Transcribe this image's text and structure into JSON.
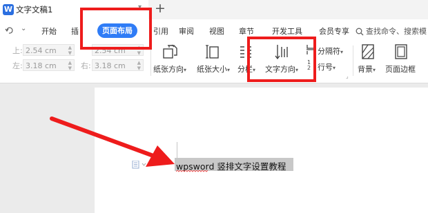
{
  "titlebar": {
    "app_icon": "W",
    "doc_title": "文字文稿1",
    "new_tab_label": "+"
  },
  "menubar": {
    "items": [
      "开始",
      "插入",
      "页面布局",
      "引用",
      "审阅",
      "视图",
      "章节",
      "开发工具",
      "会员专享"
    ],
    "partial_labels": {
      "insert": "插",
      "reference": "引用"
    },
    "active": "页面布局",
    "search_label": "查找命令、搜索模"
  },
  "ribbon": {
    "margins": {
      "top_label": "上:",
      "top_value": "2.54 cm",
      "left_label": "左:",
      "left_value": "3.18 cm",
      "right_label": "右:",
      "right_value": "3.18 cm",
      "bottom_value": "2.54 cm"
    },
    "buttons": {
      "orientation": "纸张方向",
      "paper_size": "纸张大小",
      "columns": "分栏",
      "text_direction": "文字方向",
      "breaks": "分隔符",
      "line_numbers": "行号",
      "background": "背景",
      "page_border": "页面边框"
    }
  },
  "document": {
    "text": "wpsword 竖排文字设置教程"
  },
  "colors": {
    "accent": "#2f7cf6",
    "annotation": "#ee1c1c",
    "highlight": "#c8c8c8"
  }
}
